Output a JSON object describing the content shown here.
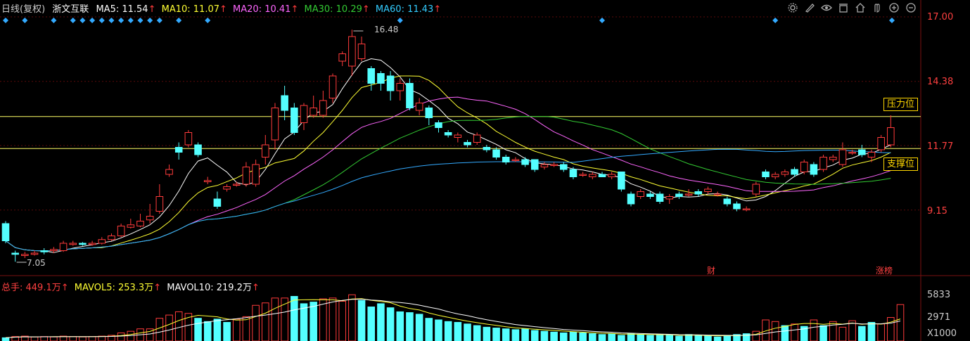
{
  "header": {
    "period": "日线(复权)",
    "name": "浙文互联",
    "ma5": "MA5: 11.54",
    "ma10": "MA10: 11.07",
    "ma20": "MA20: 10.41",
    "ma30": "MA30: 10.29",
    "ma60": "MA60: 11.43",
    "arrow": "↑"
  },
  "volume_header": {
    "total": "总手: 449.1万",
    "mavol5": "MAVOL5: 253.3万",
    "mavol10": "MAVOL10: 219.2万",
    "arrow": "↑"
  },
  "toolbar": {
    "icons": [
      "gear-icon",
      "pen-icon",
      "eye-icon",
      "layers-icon",
      "home-icon",
      "hand-icon",
      "zoom-in-icon",
      "zoom-out-icon"
    ]
  },
  "price_axis": {
    "labels": [
      "17.00",
      "14.38",
      "11.77",
      "9.15"
    ]
  },
  "volume_axis": {
    "labels": [
      "5833",
      "2971",
      "X1000"
    ]
  },
  "tags": {
    "resistance": "压力位",
    "support": "支撑位"
  },
  "annotations": {
    "high": "16.48",
    "low": "7.05",
    "finance": "财",
    "limit_list": "涨榜"
  },
  "colors": {
    "up": "#ff3b3b",
    "down": "#54ffff",
    "ma5": "#ffffff",
    "ma10": "#ffff33",
    "ma20": "#ff66ff",
    "ma30": "#33cc33",
    "ma60": "#33aaff",
    "hline": "#ffff66"
  },
  "chart_data": {
    "type": "candlestick",
    "price_range": [
      6.6,
      17.0
    ],
    "resistance_level": 12.95,
    "support_level": 11.65,
    "candles": [
      {
        "o": 8.6,
        "c": 7.9,
        "h": 8.7,
        "l": 7.8
      },
      {
        "o": 7.4,
        "c": 7.35,
        "h": 7.5,
        "l": 7.05
      },
      {
        "o": 7.3,
        "c": 7.35,
        "h": 7.45,
        "l": 7.2
      },
      {
        "o": 7.35,
        "c": 7.4,
        "h": 7.5,
        "l": 7.3
      },
      {
        "o": 7.5,
        "c": 7.45,
        "h": 7.6,
        "l": 7.35
      },
      {
        "o": 7.5,
        "c": 7.55,
        "h": 7.65,
        "l": 7.4
      },
      {
        "o": 7.5,
        "c": 7.8,
        "h": 7.9,
        "l": 7.45
      },
      {
        "o": 7.75,
        "c": 7.8,
        "h": 7.9,
        "l": 7.7
      },
      {
        "o": 7.8,
        "c": 7.75,
        "h": 7.85,
        "l": 7.7
      },
      {
        "o": 7.75,
        "c": 7.8,
        "h": 7.9,
        "l": 7.7
      },
      {
        "o": 7.8,
        "c": 7.95,
        "h": 8.05,
        "l": 7.75
      },
      {
        "o": 7.95,
        "c": 8.1,
        "h": 8.2,
        "l": 7.9
      },
      {
        "o": 8.1,
        "c": 8.5,
        "h": 8.6,
        "l": 8.05
      },
      {
        "o": 8.45,
        "c": 8.55,
        "h": 8.8,
        "l": 8.4
      },
      {
        "o": 8.5,
        "c": 8.7,
        "h": 9.0,
        "l": 8.45
      },
      {
        "o": 8.75,
        "c": 8.9,
        "h": 9.4,
        "l": 8.6
      },
      {
        "o": 9.1,
        "c": 9.7,
        "h": 10.2,
        "l": 9.0
      },
      {
        "o": 10.6,
        "c": 10.8,
        "h": 11.0,
        "l": 10.5
      },
      {
        "o": 11.7,
        "c": 11.5,
        "h": 11.9,
        "l": 11.2
      },
      {
        "o": 11.8,
        "c": 12.3,
        "h": 12.4,
        "l": 11.7
      },
      {
        "o": 11.8,
        "c": 11.4,
        "h": 11.9,
        "l": 11.3
      },
      {
        "o": 10.3,
        "c": 10.35,
        "h": 10.5,
        "l": 10.2
      },
      {
        "o": 9.6,
        "c": 9.3,
        "h": 9.9,
        "l": 9.2
      },
      {
        "o": 10.0,
        "c": 10.1,
        "h": 10.2,
        "l": 9.9
      },
      {
        "o": 10.2,
        "c": 10.2,
        "h": 10.3,
        "l": 10.1
      },
      {
        "o": 10.2,
        "c": 10.9,
        "h": 11.1,
        "l": 10.1
      },
      {
        "o": 10.2,
        "c": 11.0,
        "h": 11.2,
        "l": 10.1
      },
      {
        "o": 11.3,
        "c": 11.8,
        "h": 12.2,
        "l": 11.0
      },
      {
        "o": 12.0,
        "c": 13.3,
        "h": 13.5,
        "l": 11.6
      },
      {
        "o": 13.8,
        "c": 13.2,
        "h": 14.2,
        "l": 12.8
      },
      {
        "o": 13.3,
        "c": 12.3,
        "h": 13.5,
        "l": 12.2
      },
      {
        "o": 12.7,
        "c": 13.4,
        "h": 13.5,
        "l": 12.4
      },
      {
        "o": 13.0,
        "c": 13.3,
        "h": 13.8,
        "l": 12.9
      },
      {
        "o": 13.0,
        "c": 13.6,
        "h": 14.0,
        "l": 12.9
      },
      {
        "o": 13.7,
        "c": 14.6,
        "h": 14.7,
        "l": 13.5
      },
      {
        "o": 15.2,
        "c": 15.5,
        "h": 15.6,
        "l": 15.0
      },
      {
        "o": 15.0,
        "c": 16.2,
        "h": 16.48,
        "l": 14.6
      },
      {
        "o": 15.3,
        "c": 15.9,
        "h": 16.2,
        "l": 15.2
      },
      {
        "o": 14.9,
        "c": 14.3,
        "h": 15.0,
        "l": 14.0
      },
      {
        "o": 14.7,
        "c": 14.3,
        "h": 14.8,
        "l": 14.0
      },
      {
        "o": 14.6,
        "c": 14.0,
        "h": 14.8,
        "l": 13.6
      },
      {
        "o": 14.0,
        "c": 14.3,
        "h": 14.5,
        "l": 13.6
      },
      {
        "o": 14.3,
        "c": 13.3,
        "h": 14.5,
        "l": 13.2
      },
      {
        "o": 13.2,
        "c": 13.5,
        "h": 13.7,
        "l": 13.0
      },
      {
        "o": 13.3,
        "c": 12.9,
        "h": 13.4,
        "l": 12.6
      },
      {
        "o": 12.7,
        "c": 12.5,
        "h": 12.8,
        "l": 12.3
      },
      {
        "o": 12.3,
        "c": 12.2,
        "h": 12.4,
        "l": 12.1
      },
      {
        "o": 12.1,
        "c": 12.2,
        "h": 12.3,
        "l": 11.9
      },
      {
        "o": 11.9,
        "c": 11.8,
        "h": 12.0,
        "l": 11.7
      },
      {
        "o": 11.9,
        "c": 12.2,
        "h": 12.3,
        "l": 11.8
      },
      {
        "o": 11.7,
        "c": 11.6,
        "h": 11.8,
        "l": 11.5
      },
      {
        "o": 11.6,
        "c": 11.3,
        "h": 11.7,
        "l": 11.2
      },
      {
        "o": 11.3,
        "c": 11.1,
        "h": 11.4,
        "l": 11.0
      },
      {
        "o": 11.2,
        "c": 11.2,
        "h": 11.3,
        "l": 11.1
      },
      {
        "o": 11.2,
        "c": 11.0,
        "h": 11.3,
        "l": 10.9
      },
      {
        "o": 11.2,
        "c": 10.8,
        "h": 11.2,
        "l": 10.7
      },
      {
        "o": 10.9,
        "c": 11.0,
        "h": 11.1,
        "l": 10.8
      },
      {
        "o": 11.0,
        "c": 11.0,
        "h": 11.1,
        "l": 10.9
      },
      {
        "o": 11.0,
        "c": 10.8,
        "h": 11.1,
        "l": 10.7
      },
      {
        "o": 10.8,
        "c": 10.5,
        "h": 10.9,
        "l": 10.4
      },
      {
        "o": 10.6,
        "c": 10.6,
        "h": 10.7,
        "l": 10.5
      },
      {
        "o": 10.5,
        "c": 10.6,
        "h": 10.7,
        "l": 10.4
      },
      {
        "o": 10.6,
        "c": 10.5,
        "h": 10.7,
        "l": 10.5
      },
      {
        "o": 10.5,
        "c": 10.6,
        "h": 10.7,
        "l": 10.4
      },
      {
        "o": 10.7,
        "c": 10.0,
        "h": 10.7,
        "l": 9.9
      },
      {
        "o": 9.8,
        "c": 9.4,
        "h": 9.9,
        "l": 9.3
      },
      {
        "o": 9.7,
        "c": 9.9,
        "h": 10.0,
        "l": 9.6
      },
      {
        "o": 9.8,
        "c": 9.7,
        "h": 9.9,
        "l": 9.6
      },
      {
        "o": 9.8,
        "c": 9.5,
        "h": 9.9,
        "l": 9.4
      },
      {
        "o": 9.6,
        "c": 9.7,
        "h": 9.8,
        "l": 9.4
      },
      {
        "o": 9.8,
        "c": 9.7,
        "h": 9.9,
        "l": 9.6
      },
      {
        "o": 9.8,
        "c": 9.8,
        "h": 10.0,
        "l": 9.7
      },
      {
        "o": 9.9,
        "c": 9.8,
        "h": 10.0,
        "l": 9.7
      },
      {
        "o": 9.9,
        "c": 10.0,
        "h": 10.1,
        "l": 9.8
      },
      {
        "o": 9.8,
        "c": 9.8,
        "h": 9.9,
        "l": 9.7
      },
      {
        "o": 9.6,
        "c": 9.4,
        "h": 9.7,
        "l": 9.3
      },
      {
        "o": 9.4,
        "c": 9.2,
        "h": 9.5,
        "l": 9.1
      },
      {
        "o": 9.2,
        "c": 9.2,
        "h": 9.3,
        "l": 9.1
      },
      {
        "o": 9.8,
        "c": 10.2,
        "h": 10.3,
        "l": 9.7
      },
      {
        "o": 10.7,
        "c": 10.5,
        "h": 10.8,
        "l": 10.4
      },
      {
        "o": 10.5,
        "c": 10.6,
        "h": 10.7,
        "l": 10.4
      },
      {
        "o": 10.6,
        "c": 10.7,
        "h": 10.8,
        "l": 10.5
      },
      {
        "o": 10.8,
        "c": 10.6,
        "h": 10.9,
        "l": 10.5
      },
      {
        "o": 10.7,
        "c": 11.1,
        "h": 11.2,
        "l": 10.6
      },
      {
        "o": 11.0,
        "c": 10.6,
        "h": 11.1,
        "l": 10.5
      },
      {
        "o": 10.8,
        "c": 11.3,
        "h": 11.4,
        "l": 10.7
      },
      {
        "o": 11.2,
        "c": 11.3,
        "h": 11.4,
        "l": 11.1
      },
      {
        "o": 11.0,
        "c": 11.6,
        "h": 11.9,
        "l": 10.9
      },
      {
        "o": 11.5,
        "c": 11.5,
        "h": 11.6,
        "l": 11.4
      },
      {
        "o": 11.6,
        "c": 11.4,
        "h": 11.8,
        "l": 11.3
      },
      {
        "o": 11.3,
        "c": 11.5,
        "h": 11.6,
        "l": 11.1
      },
      {
        "o": 11.6,
        "c": 12.1,
        "h": 12.2,
        "l": 11.5
      },
      {
        "o": 11.8,
        "c": 12.5,
        "h": 13.0,
        "l": 11.7
      }
    ],
    "volume_range": [
      0,
      6500
    ],
    "volumes": [
      [
        400,
        0
      ],
      [
        550,
        1
      ],
      [
        600,
        1
      ],
      [
        500,
        1
      ],
      [
        550,
        1
      ],
      [
        500,
        1
      ],
      [
        600,
        1
      ],
      [
        550,
        1
      ],
      [
        500,
        1
      ],
      [
        550,
        1
      ],
      [
        600,
        1
      ],
      [
        700,
        1
      ],
      [
        1000,
        1
      ],
      [
        1200,
        1
      ],
      [
        1500,
        1
      ],
      [
        1500,
        1
      ],
      [
        2800,
        1
      ],
      [
        3200,
        1
      ],
      [
        3600,
        1
      ],
      [
        3400,
        1
      ],
      [
        2800,
        0
      ],
      [
        2400,
        0
      ],
      [
        2700,
        0
      ],
      [
        2300,
        0
      ],
      [
        2700,
        1
      ],
      [
        3000,
        1
      ],
      [
        4400,
        1
      ],
      [
        4700,
        1
      ],
      [
        5300,
        1
      ],
      [
        5300,
        1
      ],
      [
        5500,
        0
      ],
      [
        4600,
        0
      ],
      [
        4800,
        0
      ],
      [
        5200,
        1
      ],
      [
        5300,
        1
      ],
      [
        4900,
        1
      ],
      [
        5700,
        1
      ],
      [
        5000,
        0
      ],
      [
        4200,
        0
      ],
      [
        4600,
        0
      ],
      [
        4100,
        0
      ],
      [
        3600,
        0
      ],
      [
        3500,
        0
      ],
      [
        3300,
        0
      ],
      [
        2800,
        0
      ],
      [
        2600,
        0
      ],
      [
        2400,
        0
      ],
      [
        2300,
        0
      ],
      [
        2100,
        0
      ],
      [
        1900,
        0
      ],
      [
        1700,
        0
      ],
      [
        1600,
        0
      ],
      [
        1500,
        0
      ],
      [
        1400,
        0
      ],
      [
        1500,
        0
      ],
      [
        1300,
        0
      ],
      [
        1200,
        0
      ],
      [
        1100,
        0
      ],
      [
        1000,
        0
      ],
      [
        1100,
        0
      ],
      [
        1000,
        0
      ],
      [
        900,
        0
      ],
      [
        800,
        0
      ],
      [
        900,
        0
      ],
      [
        700,
        0
      ],
      [
        900,
        0
      ],
      [
        800,
        0
      ],
      [
        700,
        0
      ],
      [
        800,
        0
      ],
      [
        700,
        0
      ],
      [
        600,
        0
      ],
      [
        800,
        0
      ],
      [
        700,
        0
      ],
      [
        600,
        0
      ],
      [
        500,
        0
      ],
      [
        700,
        0
      ],
      [
        800,
        0
      ],
      [
        900,
        0
      ],
      [
        1200,
        1
      ],
      [
        2600,
        1
      ],
      [
        2400,
        1
      ],
      [
        1900,
        0
      ],
      [
        2100,
        1
      ],
      [
        1800,
        0
      ],
      [
        2600,
        1
      ],
      [
        1900,
        0
      ],
      [
        2400,
        1
      ],
      [
        1700,
        1
      ],
      [
        2500,
        1
      ],
      [
        1800,
        0
      ],
      [
        2300,
        0
      ],
      [
        2100,
        1
      ],
      [
        2900,
        1
      ],
      [
        4491,
        1
      ]
    ]
  }
}
